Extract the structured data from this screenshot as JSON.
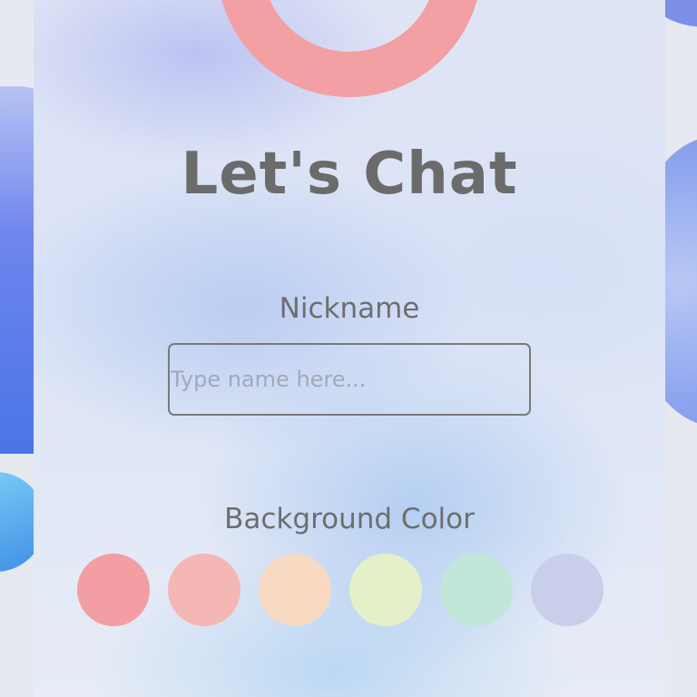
{
  "header": {
    "title": "Let's Chat"
  },
  "avatar": {
    "ring_color": "#f2a0a3"
  },
  "nickname": {
    "label": "Nickname",
    "value": "",
    "placeholder": "Type name here..."
  },
  "background_color": {
    "label": "Background Color",
    "options": [
      {
        "name": "red",
        "color": "#f29ea2"
      },
      {
        "name": "pink",
        "color": "#f5b7b4"
      },
      {
        "name": "peach",
        "color": "#f8d9c2"
      },
      {
        "name": "lime",
        "color": "#e6f0c8"
      },
      {
        "name": "mint",
        "color": "#c1e7d8"
      },
      {
        "name": "lavender",
        "color": "#c9cfea"
      }
    ]
  }
}
